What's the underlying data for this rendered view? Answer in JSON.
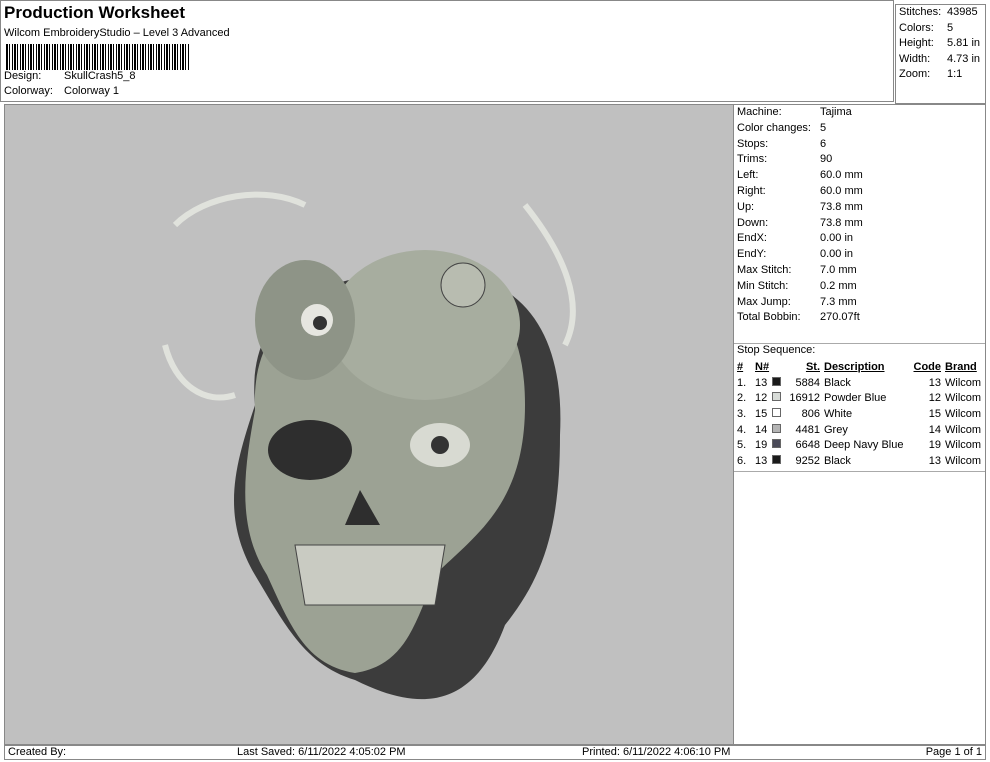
{
  "header": {
    "title": "Production Worksheet",
    "subtitle": "Wilcom EmbroideryStudio – Level 3 Advanced",
    "design_label": "Design:",
    "design_value": "SkullCrash5_8",
    "colorway_label": "Colorway:",
    "colorway_value": "Colorway 1"
  },
  "stats": [
    {
      "k": "Stitches:",
      "v": "43985"
    },
    {
      "k": "Colors:",
      "v": "5"
    },
    {
      "k": "Height:",
      "v": "5.81 in"
    },
    {
      "k": "Width:",
      "v": "4.73 in"
    },
    {
      "k": "Zoom:",
      "v": "1:1"
    }
  ],
  "info": [
    {
      "k": "Machine:",
      "v": "Tajima"
    },
    {
      "k": "Color changes:",
      "v": "5"
    },
    {
      "k": "Stops:",
      "v": "6"
    },
    {
      "k": "Trims:",
      "v": "90"
    },
    {
      "k": "Left:",
      "v": "60.0 mm"
    },
    {
      "k": "Right:",
      "v": "60.0 mm"
    },
    {
      "k": "Up:",
      "v": "73.8 mm"
    },
    {
      "k": "Down:",
      "v": "73.8 mm"
    },
    {
      "k": "EndX:",
      "v": "0.00 in"
    },
    {
      "k": "EndY:",
      "v": "0.00 in"
    },
    {
      "k": "Max Stitch:",
      "v": "7.0 mm"
    },
    {
      "k": "Min Stitch:",
      "v": "0.2 mm"
    },
    {
      "k": "Max Jump:",
      "v": "7.3 mm"
    },
    {
      "k": "Total Bobbin:",
      "v": "270.07ft"
    }
  ],
  "stop_sequence": {
    "title": "Stop Sequence:",
    "headers": {
      "num": "#",
      "n": "N#",
      "st": "St.",
      "desc": "Description",
      "code": "Code",
      "brand": "Brand"
    },
    "rows": [
      {
        "num": "1.",
        "n": "13",
        "color": "#1a1a1a",
        "st": "5884",
        "desc": "Black",
        "code": "13",
        "brand": "Wilcom"
      },
      {
        "num": "2.",
        "n": "12",
        "color": "#d8dcd8",
        "st": "16912",
        "desc": "Powder Blue",
        "code": "12",
        "brand": "Wilcom"
      },
      {
        "num": "3.",
        "n": "15",
        "color": "#ffffff",
        "st": "806",
        "desc": "White",
        "code": "15",
        "brand": "Wilcom"
      },
      {
        "num": "4.",
        "n": "14",
        "color": "#b4b4b4",
        "st": "4481",
        "desc": "Grey",
        "code": "14",
        "brand": "Wilcom"
      },
      {
        "num": "5.",
        "n": "19",
        "color": "#4a4a58",
        "st": "6648",
        "desc": "Deep Navy Blue",
        "code": "19",
        "brand": "Wilcom"
      },
      {
        "num": "6.",
        "n": "13",
        "color": "#1a1a1a",
        "st": "9252",
        "desc": "Black",
        "code": "13",
        "brand": "Wilcom"
      }
    ]
  },
  "footer": {
    "created": "Created By:",
    "saved": "Last Saved: 6/11/2022 4:05:02 PM",
    "printed": "Printed: 6/11/2022 4:06:10 PM",
    "page": "Page 1 of 1"
  }
}
